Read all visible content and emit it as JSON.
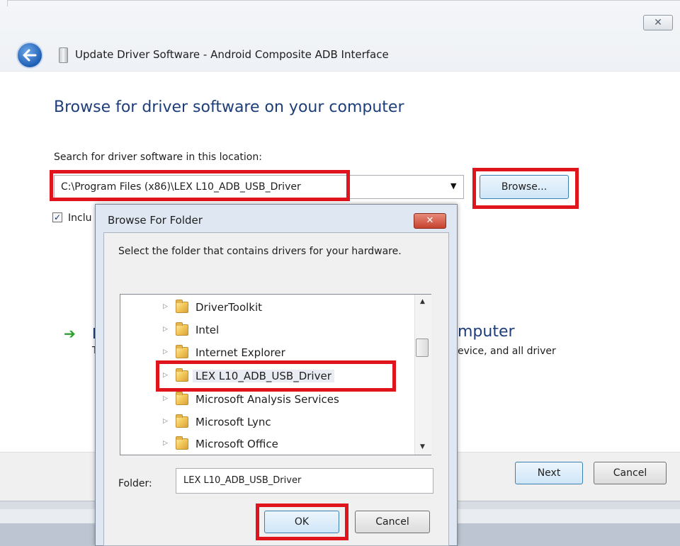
{
  "colors": {
    "highlight": "#e0141c",
    "heading": "#1e3e7a",
    "button_default_border": "#3c7fb1",
    "dialog_close": "#c4432e"
  },
  "window": {
    "title": "Update Driver Software - Android Composite ADB Interface",
    "close_glyph": "✕",
    "back_icon": "back-arrow-icon"
  },
  "page": {
    "heading": "Browse for driver software on your computer",
    "search_label": "Search for driver software in this location:",
    "path_value": "C:\\Program Files (x86)\\LEX L10_ADB_USB_Driver",
    "combo_arrow": "▼",
    "browse_label": "Browse...",
    "include_label": "Inclu",
    "include_checked": true,
    "pick_title_fragment": "L",
    "pick_title_tail": "mputer",
    "pick_desc_fragment": "T",
    "pick_desc_tail": "evice, and all driver",
    "next_label": "Next",
    "cancel_label": "Cancel"
  },
  "dialog": {
    "title": "Browse For Folder",
    "close_glyph": "✕",
    "instruction": "Select the folder that contains drivers for your hardware.",
    "tree": [
      {
        "label": "DriverToolkit",
        "selected": false
      },
      {
        "label": "Intel",
        "selected": false
      },
      {
        "label": "Internet Explorer",
        "selected": false
      },
      {
        "label": "LEX L10_ADB_USB_Driver",
        "selected": true
      },
      {
        "label": "Microsoft Analysis Services",
        "selected": false
      },
      {
        "label": "Microsoft Lync",
        "selected": false
      },
      {
        "label": "Microsoft Office",
        "selected": false
      }
    ],
    "expander_glyph": "▷",
    "scroll_up": "▲",
    "scroll_down": "▼",
    "folder_label": "Folder:",
    "folder_value": "LEX L10_ADB_USB_Driver",
    "ok_label": "OK",
    "cancel_label": "Cancel"
  }
}
